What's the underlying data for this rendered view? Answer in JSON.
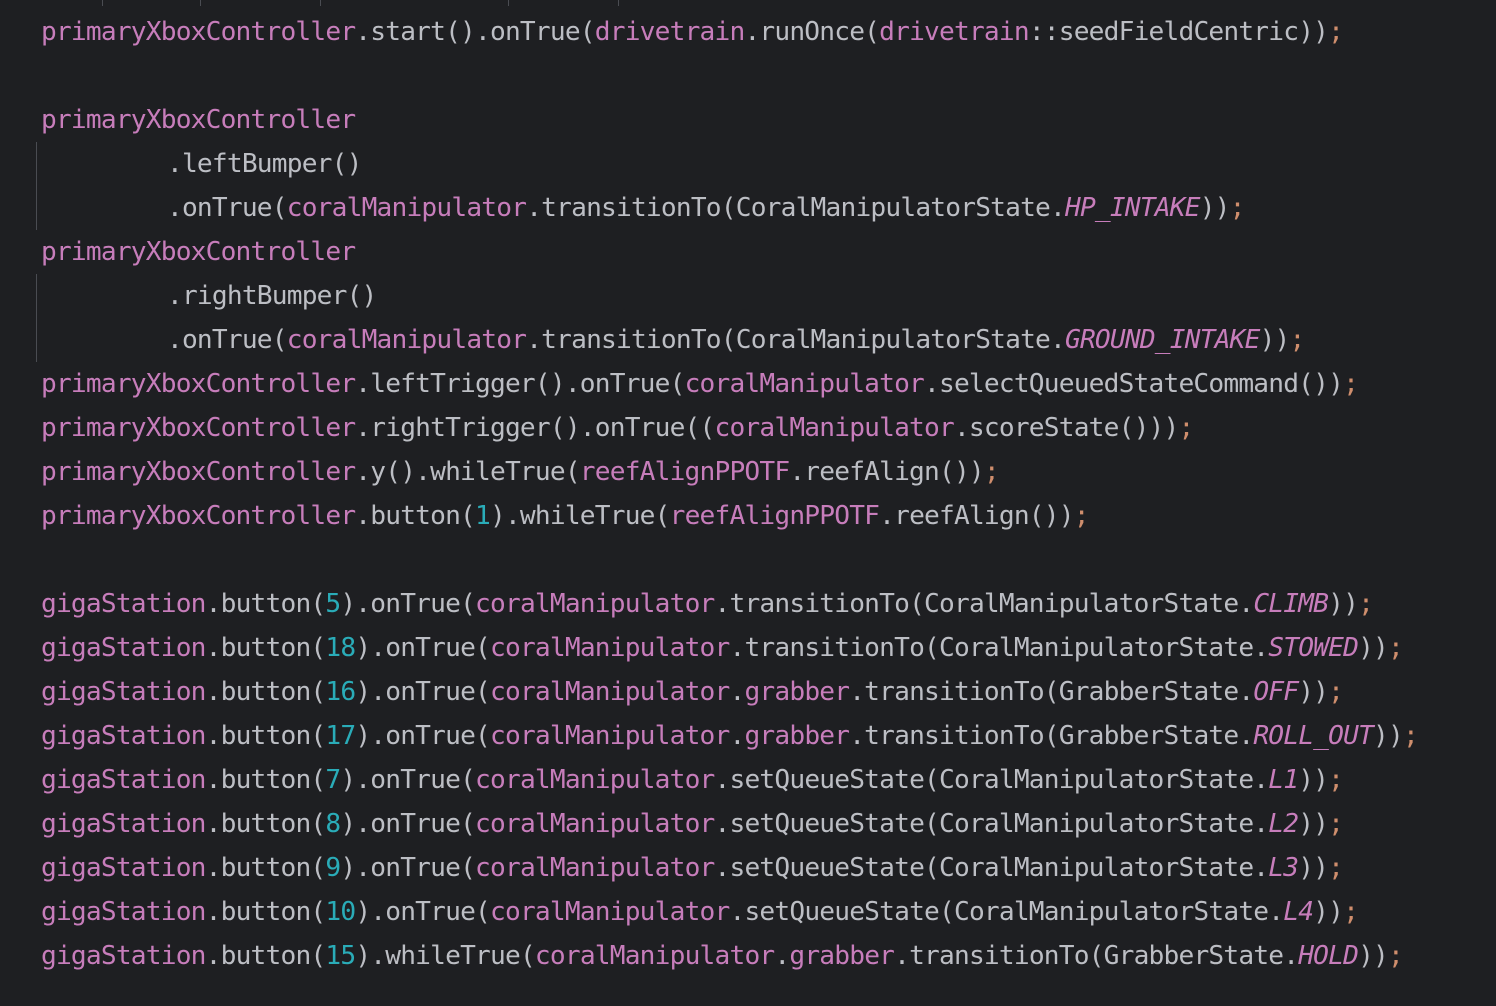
{
  "editor": {
    "language": "java",
    "theme_colors": {
      "background": "#1e1f22",
      "default_text": "#bcbec4",
      "field": "#c77dbb",
      "number": "#2aacb8",
      "semicolon": "#cf8e6d"
    },
    "lines": [
      {
        "indent": false,
        "tokens": [
          {
            "t": "primaryXboxController",
            "c": "var"
          },
          {
            "t": ".start().onTrue(",
            "c": "plain"
          },
          {
            "t": "drivetrain",
            "c": "var"
          },
          {
            "t": ".runOnce(",
            "c": "plain"
          },
          {
            "t": "drivetrain",
            "c": "var"
          },
          {
            "t": "::seedFieldCentric));",
            "c": "plain",
            "semi": true
          }
        ]
      },
      {
        "indent": false,
        "tokens": []
      },
      {
        "indent": false,
        "tokens": [
          {
            "t": "primaryXboxController",
            "c": "var"
          }
        ]
      },
      {
        "indent": true,
        "tokens": [
          {
            "t": ".leftBumper()",
            "c": "plain"
          }
        ]
      },
      {
        "indent": true,
        "tokens": [
          {
            "t": ".onTrue(",
            "c": "plain"
          },
          {
            "t": "coralManipulator",
            "c": "var"
          },
          {
            "t": ".transitionTo(CoralManipulatorState.",
            "c": "plain"
          },
          {
            "t": "HP_INTAKE",
            "c": "enum"
          },
          {
            "t": "));",
            "c": "plain",
            "semi": true
          }
        ]
      },
      {
        "indent": false,
        "tokens": [
          {
            "t": "primaryXboxController",
            "c": "var"
          }
        ]
      },
      {
        "indent": true,
        "tokens": [
          {
            "t": ".rightBumper()",
            "c": "plain"
          }
        ]
      },
      {
        "indent": true,
        "tokens": [
          {
            "t": ".onTrue(",
            "c": "plain"
          },
          {
            "t": "coralManipulator",
            "c": "var"
          },
          {
            "t": ".transitionTo(CoralManipulatorState.",
            "c": "plain"
          },
          {
            "t": "GROUND_INTAKE",
            "c": "enum"
          },
          {
            "t": "));",
            "c": "plain",
            "semi": true
          }
        ]
      },
      {
        "indent": false,
        "tokens": [
          {
            "t": "primaryXboxController",
            "c": "var"
          },
          {
            "t": ".leftTrigger().onTrue(",
            "c": "plain"
          },
          {
            "t": "coralManipulator",
            "c": "var"
          },
          {
            "t": ".selectQueuedStateCommand());",
            "c": "plain",
            "semi": true
          }
        ]
      },
      {
        "indent": false,
        "tokens": [
          {
            "t": "primaryXboxController",
            "c": "var"
          },
          {
            "t": ".rightTrigger().onTrue((",
            "c": "plain"
          },
          {
            "t": "coralManipulator",
            "c": "var"
          },
          {
            "t": ".scoreState()));",
            "c": "plain",
            "semi": true
          }
        ]
      },
      {
        "indent": false,
        "tokens": [
          {
            "t": "primaryXboxController",
            "c": "var"
          },
          {
            "t": ".y().whileTrue(",
            "c": "plain"
          },
          {
            "t": "reefAlignPPOTF",
            "c": "var"
          },
          {
            "t": ".reefAlign());",
            "c": "plain",
            "semi": true
          }
        ]
      },
      {
        "indent": false,
        "tokens": [
          {
            "t": "primaryXboxController",
            "c": "var"
          },
          {
            "t": ".button(",
            "c": "plain"
          },
          {
            "t": "1",
            "c": "num"
          },
          {
            "t": ").whileTrue(",
            "c": "plain"
          },
          {
            "t": "reefAlignPPOTF",
            "c": "var"
          },
          {
            "t": ".reefAlign());",
            "c": "plain",
            "semi": true
          }
        ]
      },
      {
        "indent": false,
        "tokens": []
      },
      {
        "indent": false,
        "tokens": [
          {
            "t": "gigaStation",
            "c": "var"
          },
          {
            "t": ".button(",
            "c": "plain"
          },
          {
            "t": "5",
            "c": "num"
          },
          {
            "t": ").onTrue(",
            "c": "plain"
          },
          {
            "t": "coralManipulator",
            "c": "var"
          },
          {
            "t": ".transitionTo(CoralManipulatorState.",
            "c": "plain"
          },
          {
            "t": "CLIMB",
            "c": "enum"
          },
          {
            "t": "));",
            "c": "plain",
            "semi": true
          }
        ]
      },
      {
        "indent": false,
        "tokens": [
          {
            "t": "gigaStation",
            "c": "var"
          },
          {
            "t": ".button(",
            "c": "plain"
          },
          {
            "t": "18",
            "c": "num"
          },
          {
            "t": ").onTrue(",
            "c": "plain"
          },
          {
            "t": "coralManipulator",
            "c": "var"
          },
          {
            "t": ".transitionTo(CoralManipulatorState.",
            "c": "plain"
          },
          {
            "t": "STOWED",
            "c": "enum"
          },
          {
            "t": "));",
            "c": "plain",
            "semi": true
          }
        ]
      },
      {
        "indent": false,
        "tokens": [
          {
            "t": "gigaStation",
            "c": "var"
          },
          {
            "t": ".button(",
            "c": "plain"
          },
          {
            "t": "16",
            "c": "num"
          },
          {
            "t": ").onTrue(",
            "c": "plain"
          },
          {
            "t": "coralManipulator",
            "c": "var"
          },
          {
            "t": ".",
            "c": "plain"
          },
          {
            "t": "grabber",
            "c": "var"
          },
          {
            "t": ".transitionTo(GrabberState.",
            "c": "plain"
          },
          {
            "t": "OFF",
            "c": "enum"
          },
          {
            "t": "));",
            "c": "plain",
            "semi": true
          }
        ]
      },
      {
        "indent": false,
        "tokens": [
          {
            "t": "gigaStation",
            "c": "var"
          },
          {
            "t": ".button(",
            "c": "plain"
          },
          {
            "t": "17",
            "c": "num"
          },
          {
            "t": ").onTrue(",
            "c": "plain"
          },
          {
            "t": "coralManipulator",
            "c": "var"
          },
          {
            "t": ".",
            "c": "plain"
          },
          {
            "t": "grabber",
            "c": "var"
          },
          {
            "t": ".transitionTo(GrabberState.",
            "c": "plain"
          },
          {
            "t": "ROLL_OUT",
            "c": "enum"
          },
          {
            "t": "));",
            "c": "plain",
            "semi": true
          }
        ]
      },
      {
        "indent": false,
        "tokens": [
          {
            "t": "gigaStation",
            "c": "var"
          },
          {
            "t": ".button(",
            "c": "plain"
          },
          {
            "t": "7",
            "c": "num"
          },
          {
            "t": ").onTrue(",
            "c": "plain"
          },
          {
            "t": "coralManipulator",
            "c": "var"
          },
          {
            "t": ".setQueueState(CoralManipulatorState.",
            "c": "plain"
          },
          {
            "t": "L1",
            "c": "enum"
          },
          {
            "t": "));",
            "c": "plain",
            "semi": true
          }
        ]
      },
      {
        "indent": false,
        "tokens": [
          {
            "t": "gigaStation",
            "c": "var"
          },
          {
            "t": ".button(",
            "c": "plain"
          },
          {
            "t": "8",
            "c": "num"
          },
          {
            "t": ").onTrue(",
            "c": "plain"
          },
          {
            "t": "coralManipulator",
            "c": "var"
          },
          {
            "t": ".setQueueState(CoralManipulatorState.",
            "c": "plain"
          },
          {
            "t": "L2",
            "c": "enum"
          },
          {
            "t": "));",
            "c": "plain",
            "semi": true
          }
        ]
      },
      {
        "indent": false,
        "tokens": [
          {
            "t": "gigaStation",
            "c": "var"
          },
          {
            "t": ".button(",
            "c": "plain"
          },
          {
            "t": "9",
            "c": "num"
          },
          {
            "t": ").onTrue(",
            "c": "plain"
          },
          {
            "t": "coralManipulator",
            "c": "var"
          },
          {
            "t": ".setQueueState(CoralManipulatorState.",
            "c": "plain"
          },
          {
            "t": "L3",
            "c": "enum"
          },
          {
            "t": "));",
            "c": "plain",
            "semi": true
          }
        ]
      },
      {
        "indent": false,
        "tokens": [
          {
            "t": "gigaStation",
            "c": "var"
          },
          {
            "t": ".button(",
            "c": "plain"
          },
          {
            "t": "10",
            "c": "num"
          },
          {
            "t": ").onTrue(",
            "c": "plain"
          },
          {
            "t": "coralManipulator",
            "c": "var"
          },
          {
            "t": ".setQueueState(CoralManipulatorState.",
            "c": "plain"
          },
          {
            "t": "L4",
            "c": "enum"
          },
          {
            "t": "));",
            "c": "plain",
            "semi": true
          }
        ]
      },
      {
        "indent": false,
        "tokens": [
          {
            "t": "gigaStation",
            "c": "var"
          },
          {
            "t": ".button(",
            "c": "plain"
          },
          {
            "t": "15",
            "c": "num"
          },
          {
            "t": ").whileTrue(",
            "c": "plain"
          },
          {
            "t": "coralManipulator",
            "c": "var"
          },
          {
            "t": ".",
            "c": "plain"
          },
          {
            "t": "grabber",
            "c": "var"
          },
          {
            "t": ".transitionTo(GrabberState.",
            "c": "plain"
          },
          {
            "t": "HOLD",
            "c": "enum"
          },
          {
            "t": "));",
            "c": "plain",
            "semi": true
          }
        ]
      }
    ]
  }
}
